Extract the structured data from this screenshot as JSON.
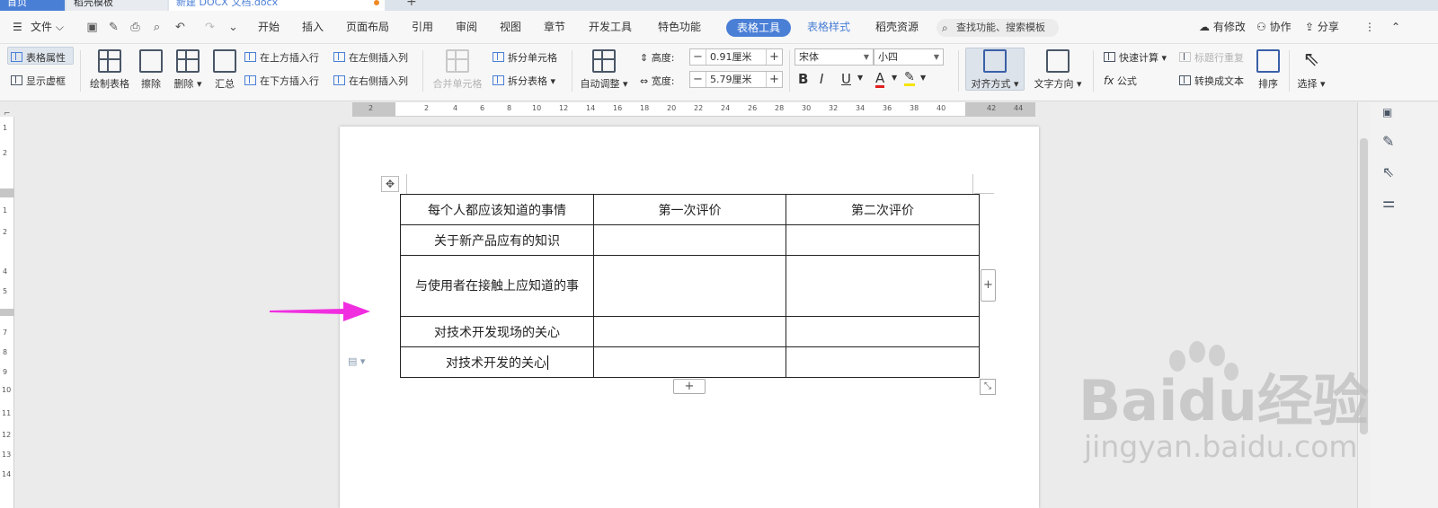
{
  "tabs": {
    "home": "首页",
    "template": "稻壳模板",
    "document": "新建 DOCX 文档.docx",
    "add": "+"
  },
  "menubar": {
    "file": "文件",
    "items": [
      "开始",
      "插入",
      "页面布局",
      "引用",
      "审阅",
      "视图",
      "章节",
      "开发工具",
      "特色功能"
    ],
    "active_tab": "表格工具",
    "table_style": "表格样式",
    "resources": "稻壳资源",
    "search_placeholder": "查找功能、搜索模板",
    "has_changes": "有修改",
    "collaborate": "协作",
    "share": "分享"
  },
  "ribbon": {
    "table_props": "表格属性",
    "show_gridlines": "显示虚框",
    "draw_table": "绘制表格",
    "erase": "擦除",
    "delete": "删除",
    "summary": "汇总",
    "insert_above": "在上方插入行",
    "insert_below": "在下方插入行",
    "insert_left": "在左侧插入列",
    "insert_right": "在右侧插入列",
    "merge_cells": "合并单元格",
    "split_cells": "拆分单元格",
    "split_table": "拆分表格",
    "auto_adjust": "自动调整",
    "height_label": "高度:",
    "height_value": "0.91厘米",
    "width_label": "宽度:",
    "width_value": "5.79厘米",
    "font": "宋体",
    "font_size": "小四",
    "bold": "B",
    "italic": "I",
    "underline": "U",
    "font_color": "A",
    "align": "对齐方式",
    "text_direction": "文字方向",
    "quick_calc": "快速计算",
    "repeat_header": "标题行重复",
    "formula": "公式",
    "to_text": "转换成文本",
    "sort": "排序",
    "select": "选择"
  },
  "ruler": {
    "top_ticks": [
      "2",
      "2",
      "4",
      "6",
      "8",
      "10",
      "12",
      "14",
      "16",
      "18",
      "20",
      "22",
      "24",
      "26",
      "28",
      "30",
      "32",
      "34",
      "36",
      "38",
      "40",
      "42",
      "44"
    ],
    "left_ticks": [
      "1",
      "2",
      "1",
      "2",
      "4",
      "5",
      "7",
      "8",
      "9",
      "10",
      "11",
      "12",
      "13",
      "14"
    ]
  },
  "table": {
    "rows": [
      [
        "每个人都应该知道的事情",
        "第一次评价",
        "第二次评价"
      ],
      [
        "关于新产品应有的知识",
        "",
        ""
      ],
      [
        "与使用者在接触上应知道的事",
        "",
        ""
      ],
      [
        "对技术开发现场的关心",
        "",
        ""
      ],
      [
        "对技术开发的关心",
        "",
        ""
      ]
    ]
  },
  "watermark": {
    "brand": "Baidu经验",
    "url": "jingyan.baidu.com"
  },
  "colors": {
    "accent": "#4a7fd6",
    "arrow": "#f02ee0"
  }
}
